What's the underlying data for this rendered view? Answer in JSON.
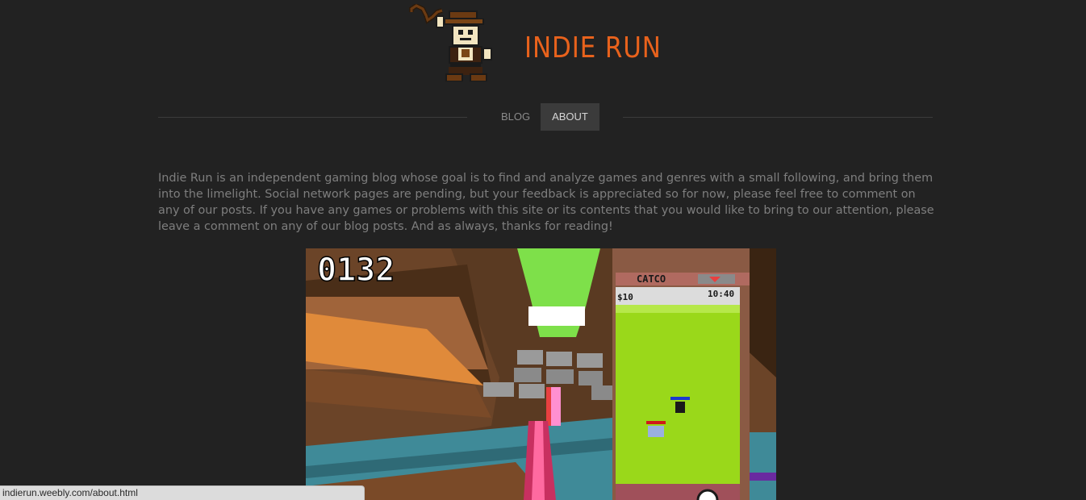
{
  "header": {
    "site_title": "INDIE RUN",
    "logo_icon": "pixel-adventurer-with-whip-icon"
  },
  "nav": {
    "items": [
      {
        "label": "BLOG",
        "active": false
      },
      {
        "label": "ABOUT",
        "active": true
      }
    ]
  },
  "main": {
    "about_text": "Indie Run is an independent gaming blog whose goal is to find and analyze games and genres with a small following, and bring them into the limelight. Social network pages are pending, but your feedback is appreciated so for now, please feel free to comment on any of our posts. If you have any games or problems with this site or its contents that you would like to bring to our attention, please leave a comment on any of our blog posts. And as always, thanks for reading!",
    "game_screenshot": {
      "score": "0132",
      "panel_title": "CATCO",
      "money": "$10",
      "time": "10:40"
    }
  },
  "status_bar": {
    "url": "indierun.weebly.com/about.html"
  },
  "colors": {
    "background": "#222222",
    "accent": "#e8621c",
    "text": "#7e7e7e",
    "nav_active_bg": "#3b3b3b"
  }
}
